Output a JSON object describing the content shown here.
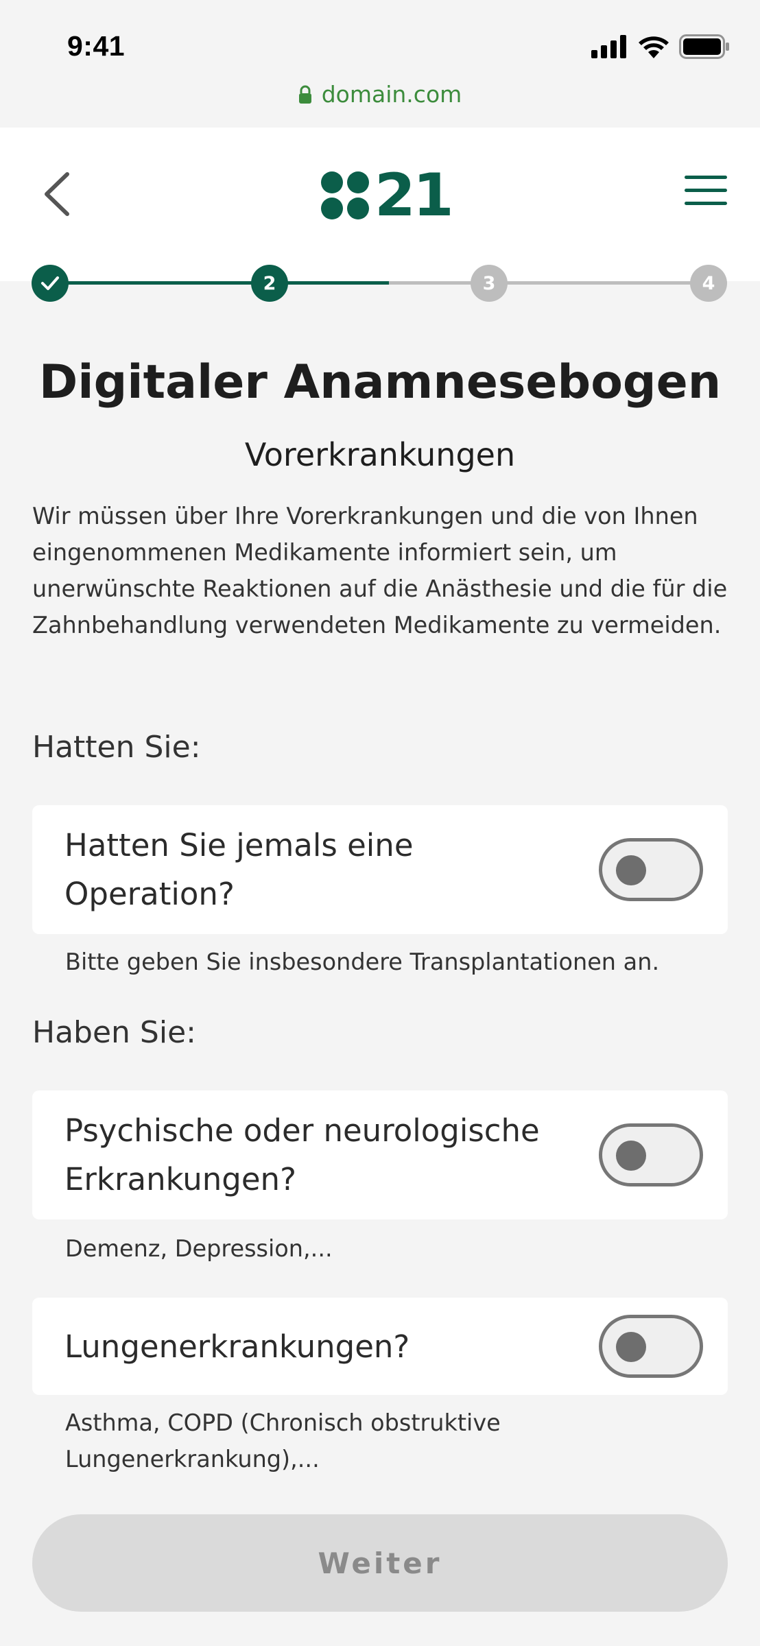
{
  "status_bar": {
    "time": "9:41"
  },
  "browser": {
    "url": "domain.com"
  },
  "header": {
    "logo_text": "21"
  },
  "stepper": {
    "steps": [
      {
        "label": "✓",
        "state": "done"
      },
      {
        "label": "2",
        "state": "current"
      },
      {
        "label": "3",
        "state": "todo"
      },
      {
        "label": "4",
        "state": "todo"
      }
    ]
  },
  "page": {
    "title": "Digitaler Anamnesebogen",
    "subtitle": "Vorerkrankungen",
    "intro": "Wir müssen über Ihre Vorerkrankungen und die von Ihnen eingenommenen Medikamente informiert sein, um unerwünschte Reaktionen auf die Anästhesie und die für die Zahnbehandlung verwendeten Medikamente zu vermeiden."
  },
  "sections": [
    {
      "heading": "Hatten Sie:",
      "questions": [
        {
          "label": "Hatten Sie jemals eine Operation?",
          "hint": "Bitte geben Sie insbesondere Transplantationen an.",
          "value": false
        }
      ]
    },
    {
      "heading": "Haben Sie:",
      "questions": [
        {
          "label": "Psychische oder neurologische Erkrankungen?",
          "hint": "Demenz, Depression,...",
          "value": false
        },
        {
          "label": "Lungenerkrankungen?",
          "hint": "Asthma, COPD (Chronisch obstruktive Lungenerkrankung),...",
          "value": false
        }
      ]
    }
  ],
  "actions": {
    "next_label": "Weiter"
  },
  "colors": {
    "brand": "#0b5e4a",
    "url_green": "#3c8c3c",
    "step_inactive": "#bdbdbd",
    "button_disabled_bg": "#dadada"
  }
}
